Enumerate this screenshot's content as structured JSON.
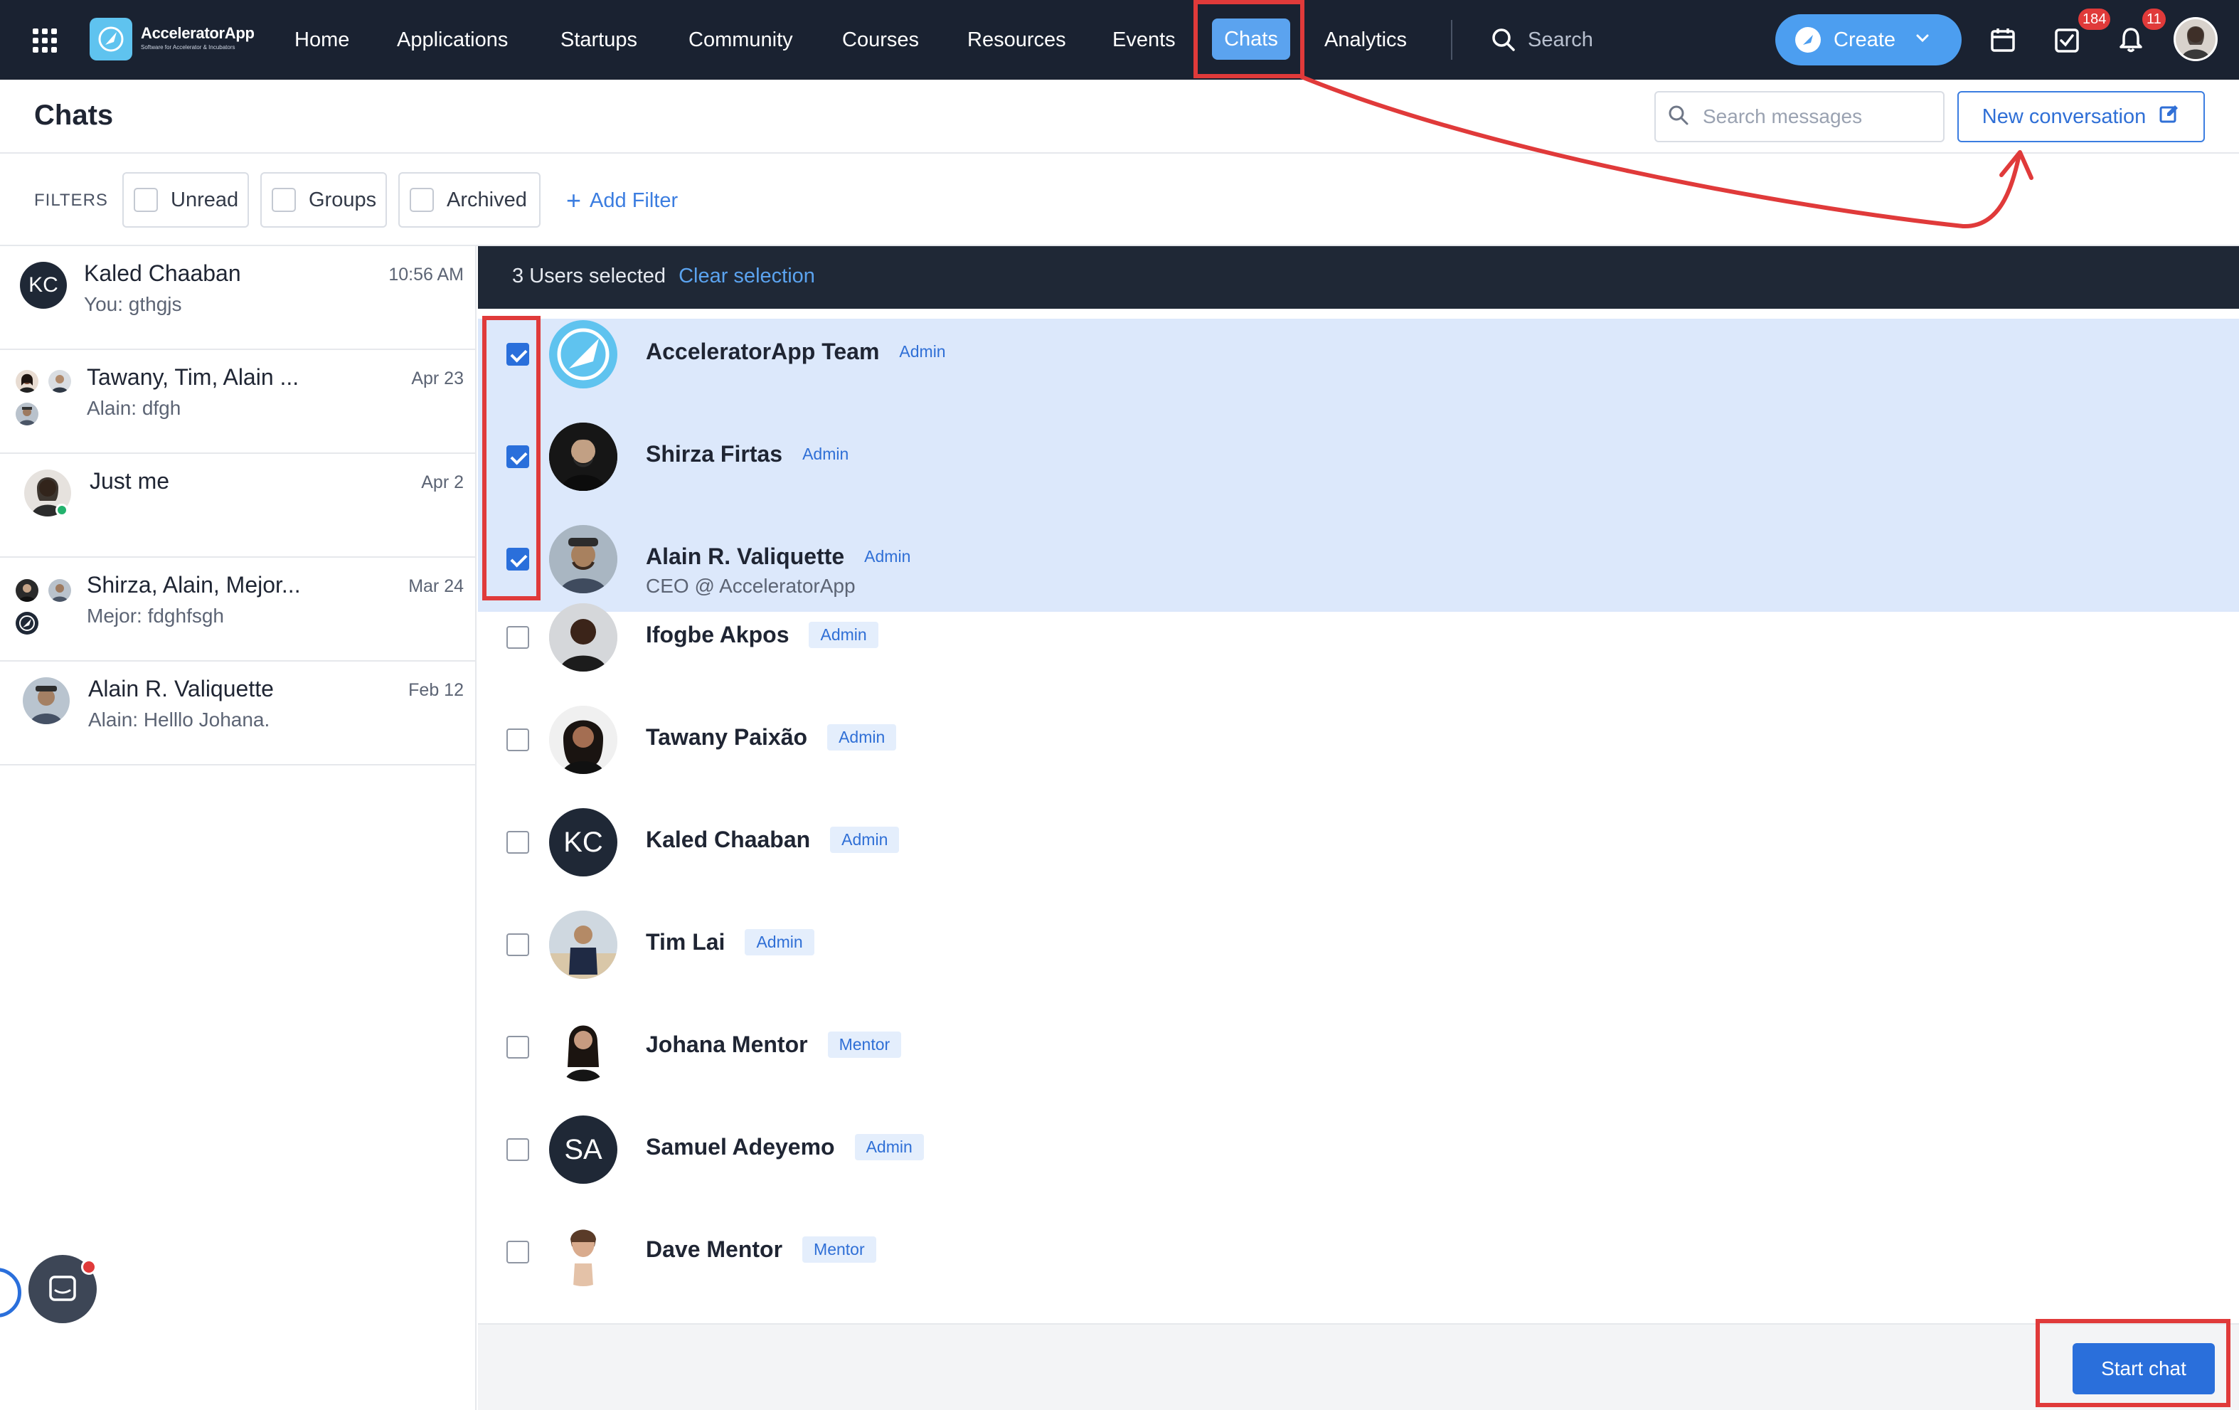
{
  "app": {
    "name": "AcceleratorApp",
    "tagline": "Software for Accelerator & Incubators"
  },
  "nav": {
    "items": [
      {
        "label": "Home"
      },
      {
        "label": "Applications"
      },
      {
        "label": "Startups"
      },
      {
        "label": "Community"
      },
      {
        "label": "Courses"
      },
      {
        "label": "Resources"
      },
      {
        "label": "Events"
      },
      {
        "label": "Chats",
        "active": true
      },
      {
        "label": "Analytics"
      }
    ],
    "search_placeholder": "Search",
    "create_label": "Create",
    "tasks_badge": "184",
    "notifications_badge": "11"
  },
  "header": {
    "title": "Chats",
    "search_placeholder": "Search messages",
    "new_conversation_label": "New conversation"
  },
  "filters": {
    "label": "FILTERS",
    "options": [
      {
        "label": "Unread"
      },
      {
        "label": "Groups"
      },
      {
        "label": "Archived"
      }
    ],
    "add_filter_label": "Add Filter"
  },
  "conversations": [
    {
      "name": "Kaled Chaaban",
      "preview": "You: gthgjs",
      "date": "10:56 AM",
      "avatar_initials": "KC"
    },
    {
      "name": "Tawany, Tim, Alain ...",
      "preview": "Alain: dfgh",
      "date": "Apr 23"
    },
    {
      "name": "Just me",
      "preview": "",
      "date": "Apr 2"
    },
    {
      "name": "Shirza, Alain, Mejor...",
      "preview": "Mejor: fdghfsgh",
      "date": "Mar 24"
    },
    {
      "name": "Alain R. Valiquette",
      "preview": "Alain: Helllo Johana.",
      "date": "Feb 12"
    }
  ],
  "selection": {
    "count": "3",
    "text": "Users selected",
    "clear_label": "Clear selection"
  },
  "users": [
    {
      "name": "AcceleratorApp Team",
      "role": "Admin",
      "selected": true,
      "subtitle": ""
    },
    {
      "name": "Shirza Firtas",
      "role": "Admin",
      "selected": true,
      "subtitle": ""
    },
    {
      "name": "Alain R. Valiquette",
      "role": "Admin",
      "selected": true,
      "subtitle": "CEO @ AcceleratorApp"
    },
    {
      "name": "Ifogbe Akpos",
      "role": "Admin",
      "selected": false,
      "subtitle": ""
    },
    {
      "name": "Tawany Paixão",
      "role": "Admin",
      "selected": false,
      "subtitle": ""
    },
    {
      "name": "Kaled Chaaban",
      "role": "Admin",
      "selected": false,
      "subtitle": "",
      "initials": "KC"
    },
    {
      "name": "Tim Lai",
      "role": "Admin",
      "selected": false,
      "subtitle": ""
    },
    {
      "name": "Johana Mentor",
      "role": "Mentor",
      "selected": false,
      "subtitle": ""
    },
    {
      "name": "Samuel Adeyemo",
      "role": "Admin",
      "selected": false,
      "subtitle": "",
      "initials": "SA"
    },
    {
      "name": "Dave Mentor",
      "role": "Mentor",
      "selected": false,
      "subtitle": ""
    }
  ],
  "footer": {
    "start_chat_label": "Start chat"
  },
  "colors": {
    "nav_bg": "#1a2231",
    "accent": "#2a6fdb",
    "nav_active": "#5ba3ef",
    "selected_row": "#dce8fb",
    "annotation": "#e03a3a"
  }
}
